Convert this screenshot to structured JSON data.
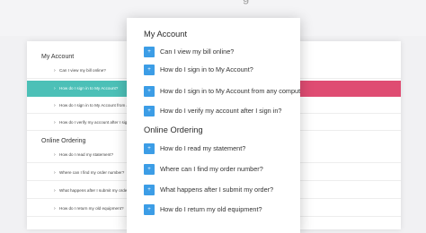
{
  "colors": {
    "accent_teal": "#4cc0b7",
    "accent_pink": "#df4c72",
    "button_blue": "#3c9de6"
  },
  "header": {
    "title_fragment": "g"
  },
  "left_panel": {
    "sections": [
      {
        "title": "My Account",
        "items": [
          {
            "label": "Can I view my bill online?"
          },
          {
            "label": "How do I sign in to My Account?",
            "active": true
          },
          {
            "label": "How do I sign in to My Account from any compute"
          },
          {
            "label": "How do I verify my account after I sign in?"
          }
        ]
      },
      {
        "title": "Online Ordering",
        "items": [
          {
            "label": "How do I read my statement?"
          },
          {
            "label": "Where can I find my order number?"
          },
          {
            "label": "What happens after I submit my order?"
          },
          {
            "label": "How do I return my old equipment?"
          }
        ]
      }
    ]
  },
  "main_panel": {
    "sections": [
      {
        "title": "My Account",
        "items": [
          {
            "label": "Can I view my bill online?",
            "icon": "plus-icon"
          },
          {
            "label": "How do I sign in to My Account?",
            "icon": "plus-icon"
          },
          {
            "label": "How do I sign in to My Account from any computer?",
            "icon": "plus-icon"
          },
          {
            "label": "How do I verify my account after I sign in?",
            "icon": "plus-icon"
          }
        ]
      },
      {
        "title": "Online Ordering",
        "items": [
          {
            "label": "How do I read my statement?",
            "icon": "plus-icon"
          },
          {
            "label": "Where can I find my order number?",
            "icon": "plus-icon"
          },
          {
            "label": "What happens after I submit my order?",
            "icon": "plus-icon"
          },
          {
            "label": "How do I return my old equipment?",
            "icon": "plus-icon"
          }
        ]
      }
    ]
  }
}
